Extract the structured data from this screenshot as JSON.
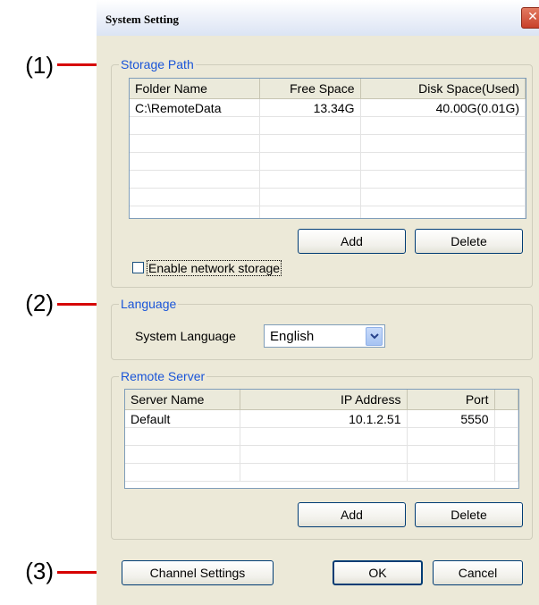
{
  "callouts": [
    "(1)",
    "(2)",
    "(3)"
  ],
  "window": {
    "title": "System Setting",
    "close_glyph": "✕"
  },
  "storage": {
    "group_title": "Storage Path",
    "columns": [
      "Folder Name",
      "Free Space",
      "Disk Space(Used)"
    ],
    "rows": [
      [
        "C:\\RemoteData",
        "13.34G",
        "40.00G(0.01G)"
      ]
    ],
    "add_label": "Add",
    "delete_label": "Delete",
    "network_checkbox_label": "Enable network storage",
    "network_checked": false
  },
  "language": {
    "group_title": "Language",
    "field_label": "System Language",
    "selected": "English"
  },
  "remote_server": {
    "group_title": "Remote Server",
    "columns": [
      "Server Name",
      "IP Address",
      "Port"
    ],
    "rows": [
      [
        "Default",
        "10.1.2.51",
        "5550"
      ]
    ],
    "add_label": "Add",
    "delete_label": "Delete"
  },
  "footer": {
    "channel_settings_label": "Channel Settings",
    "ok_label": "OK",
    "cancel_label": "Cancel"
  },
  "colors": {
    "group_title": "#1a55d8",
    "callout_line": "#d60000",
    "window_bg": "#ece9d8"
  }
}
